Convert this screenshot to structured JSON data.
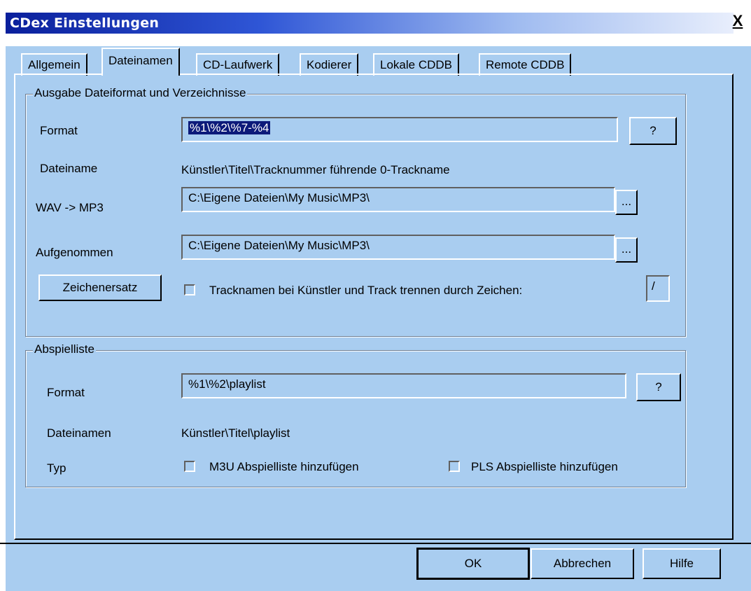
{
  "window": {
    "title": "CDex Einstellungen",
    "close_label": "X"
  },
  "tabs": [
    "Allgemein",
    "Dateinamen",
    "CD-Laufwerk",
    "Kodierer",
    "Lokale CDDB",
    "Remote CDDB"
  ],
  "output_group": {
    "label": "Ausgabe Dateiformat und Verzeichnisse",
    "format_label": "Format",
    "format_value": "%1\\%2\\%7-%4",
    "help_label": "?",
    "filename_label": "Dateiname",
    "filename_value": "Künstler\\Titel\\Tracknummer führende 0-Trackname",
    "wav_mp3_label": "WAV -> MP3",
    "wav_mp3_value": "C:\\Eigene Dateien\\My Music\\MP3\\",
    "recorded_label": "Aufgenommen",
    "recorded_value": "C:\\Eigene Dateien\\My Music\\MP3\\",
    "browse_label": "...",
    "char_replace_label": "Zeichenersatz",
    "split_label": "Tracknamen bei Künstler und Track trennen durch Zeichen:",
    "split_char": "/"
  },
  "playlist_group": {
    "label": "Abspielliste",
    "format_label": "Format",
    "format_value": "%1\\%2\\playlist",
    "help_label": "?",
    "filename_label": "Dateinamen",
    "filename_value": "Künstler\\Titel\\playlist",
    "type_label": "Typ",
    "m3u_label": "M3U Abspielliste hinzufügen",
    "pls_label": "PLS Abspielliste hinzufügen"
  },
  "buttons": {
    "ok": "OK",
    "cancel": "Abbrechen",
    "help": "Hilfe"
  },
  "colors": {
    "background": "#a9cdf0",
    "title_start": "#0a1f9c",
    "selection": "#0c1a7a"
  }
}
